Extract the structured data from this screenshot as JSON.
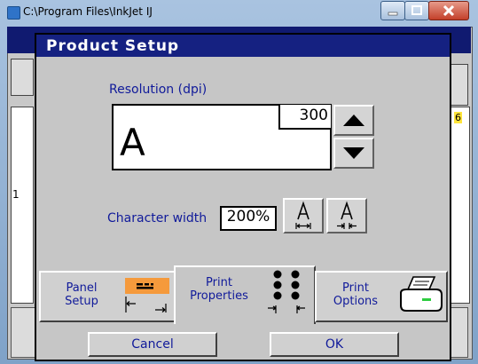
{
  "window": {
    "title": "C:\\Program Files\\InkJet  IJ"
  },
  "background": {
    "left_number": "1",
    "right_number": "6"
  },
  "dialog": {
    "title": "Product Setup",
    "resolution": {
      "label": "Resolution (dpi)",
      "value": "300",
      "preview_glyph": "A"
    },
    "character_width": {
      "label": "Character width",
      "value": "200%"
    },
    "tabs": [
      {
        "label_line1": "Panel",
        "label_line2": "Setup",
        "active": false
      },
      {
        "label_line1": "Print",
        "label_line2": "Properties",
        "active": true
      },
      {
        "label_line1": "Print",
        "label_line2": "Options",
        "active": false
      }
    ],
    "buttons": {
      "cancel": "Cancel",
      "ok": "OK"
    }
  },
  "icons": {
    "spin_up": "triangle-up-icon",
    "spin_down": "triangle-down-icon",
    "wider": "char-width-increase-icon",
    "narrower": "char-width-decrease-icon",
    "panel": "panel-setup-icon",
    "dots": "print-properties-dots-icon",
    "printer": "printer-icon"
  },
  "colors": {
    "title_bar": "#152181",
    "label_text": "#101a9a",
    "panel_icon_accent": "#f59a3c",
    "dialog_bg": "#c6c6c6"
  }
}
